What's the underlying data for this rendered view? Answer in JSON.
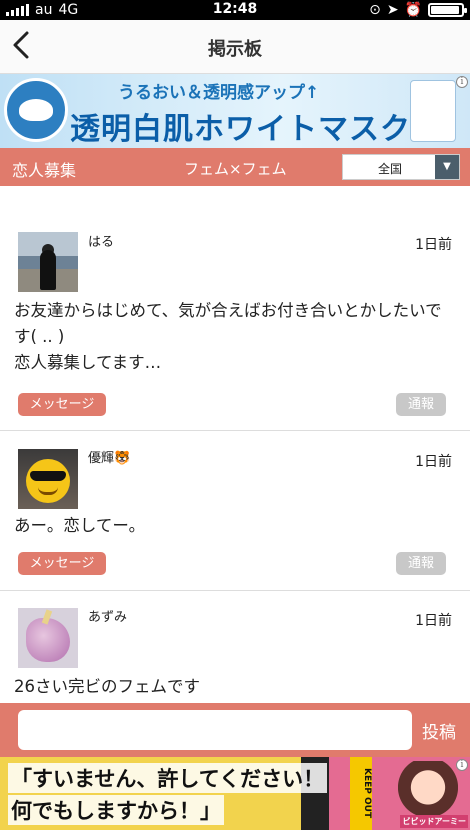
{
  "status_bar": {
    "carrier": "au",
    "network": "4G",
    "time": "12:48"
  },
  "nav": {
    "title": "掲示板",
    "back_icon": "chevron-left-icon"
  },
  "top_ad": {
    "subtitle": "うるおい＆透明感アップ↑",
    "headline": "透明白肌ホワイトマスク",
    "info_label": "i"
  },
  "filter": {
    "category": "恋人募集",
    "type": "フェム×フェム",
    "region": "全国"
  },
  "posts": [
    {
      "username": "はる",
      "time": "1日前",
      "body": "お友達からはじめて、気が合えばお付き合いとかしたいです( .. )\n恋人募集してます…",
      "message_label": "メッセージ",
      "report_label": "通報"
    },
    {
      "username": "優輝🐯",
      "time": "1日前",
      "body": "あー。恋してー。",
      "message_label": "メッセージ",
      "report_label": "通報"
    },
    {
      "username": "あずみ",
      "time": "1日前",
      "body": "26さい完ビのフェムです"
    }
  ],
  "composer": {
    "placeholder": "",
    "submit_label": "投稿"
  },
  "bottom_ad": {
    "line1": "「すいません、許してください！",
    "line2": "何でもしますから！」",
    "tape_text": "KEEP OUT",
    "logo": "ビビッドアーミー",
    "info_label": "i"
  },
  "colors": {
    "accent": "#e07b6c",
    "report_gray": "#c8c8c8"
  }
}
